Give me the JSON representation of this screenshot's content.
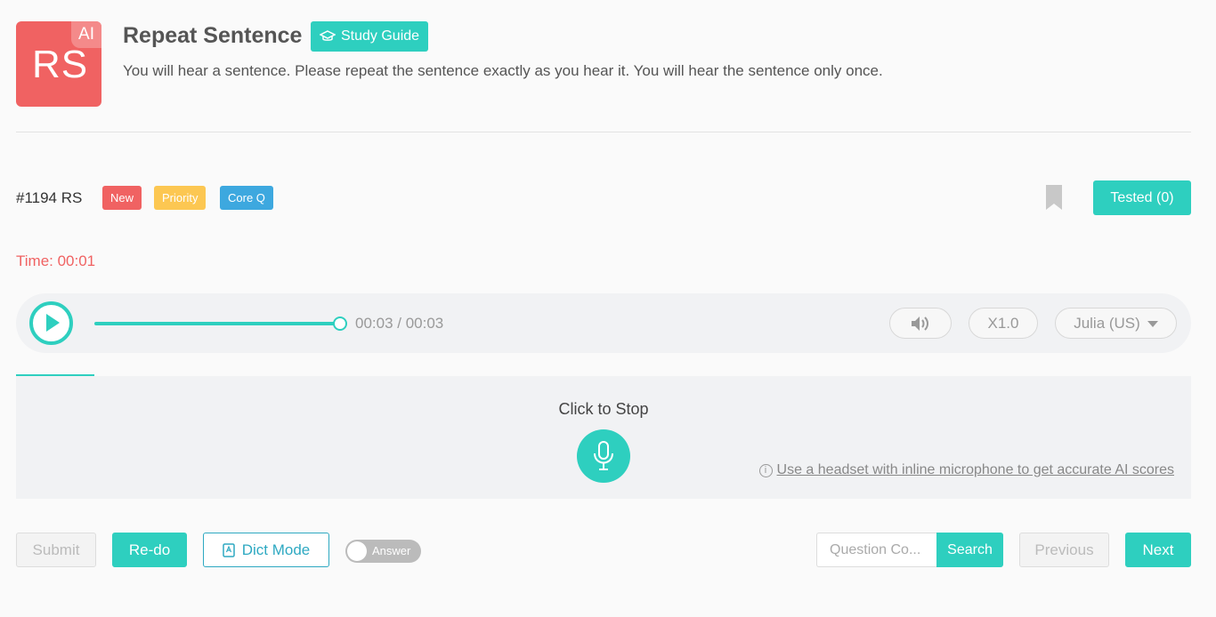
{
  "header": {
    "logo_text": "RS",
    "logo_badge": "AI",
    "title": "Repeat Sentence",
    "study_guide_label": "Study Guide",
    "instruction": "You will hear a sentence. Please repeat the sentence exactly as you hear it. You will hear the sentence only once."
  },
  "question": {
    "id": "#1194 RS",
    "tags": {
      "new": "New",
      "priority": "Priority",
      "core": "Core Q"
    },
    "tested_label": "Tested (0)"
  },
  "timer": {
    "text": "Time: 00:01"
  },
  "player": {
    "time_display": "00:03 / 00:03",
    "progress": 1.0,
    "speed_label": "X1.0",
    "voice_label": "Julia (US)"
  },
  "recorder": {
    "label": "Click to Stop",
    "hint_text": "Use a headset with inline microphone to get accurate AI scores"
  },
  "footer": {
    "submit_label": "Submit",
    "redo_label": "Re-do",
    "dict_mode_label": "Dict Mode",
    "answer_toggle_label": "Answer",
    "search_placeholder": "Question Co...",
    "search_label": "Search",
    "previous_label": "Previous",
    "next_label": "Next"
  },
  "colors": {
    "accent": "#2ecfbf",
    "danger": "#f06262",
    "priority": "#fcc752",
    "core": "#3da8df"
  },
  "icons": {
    "study_guide": "graduation-cap-icon",
    "bookmark": "bookmark-icon",
    "play": "play-icon",
    "volume": "speaker-icon",
    "mic": "microphone-icon",
    "info": "info-icon",
    "dict": "book-icon"
  }
}
